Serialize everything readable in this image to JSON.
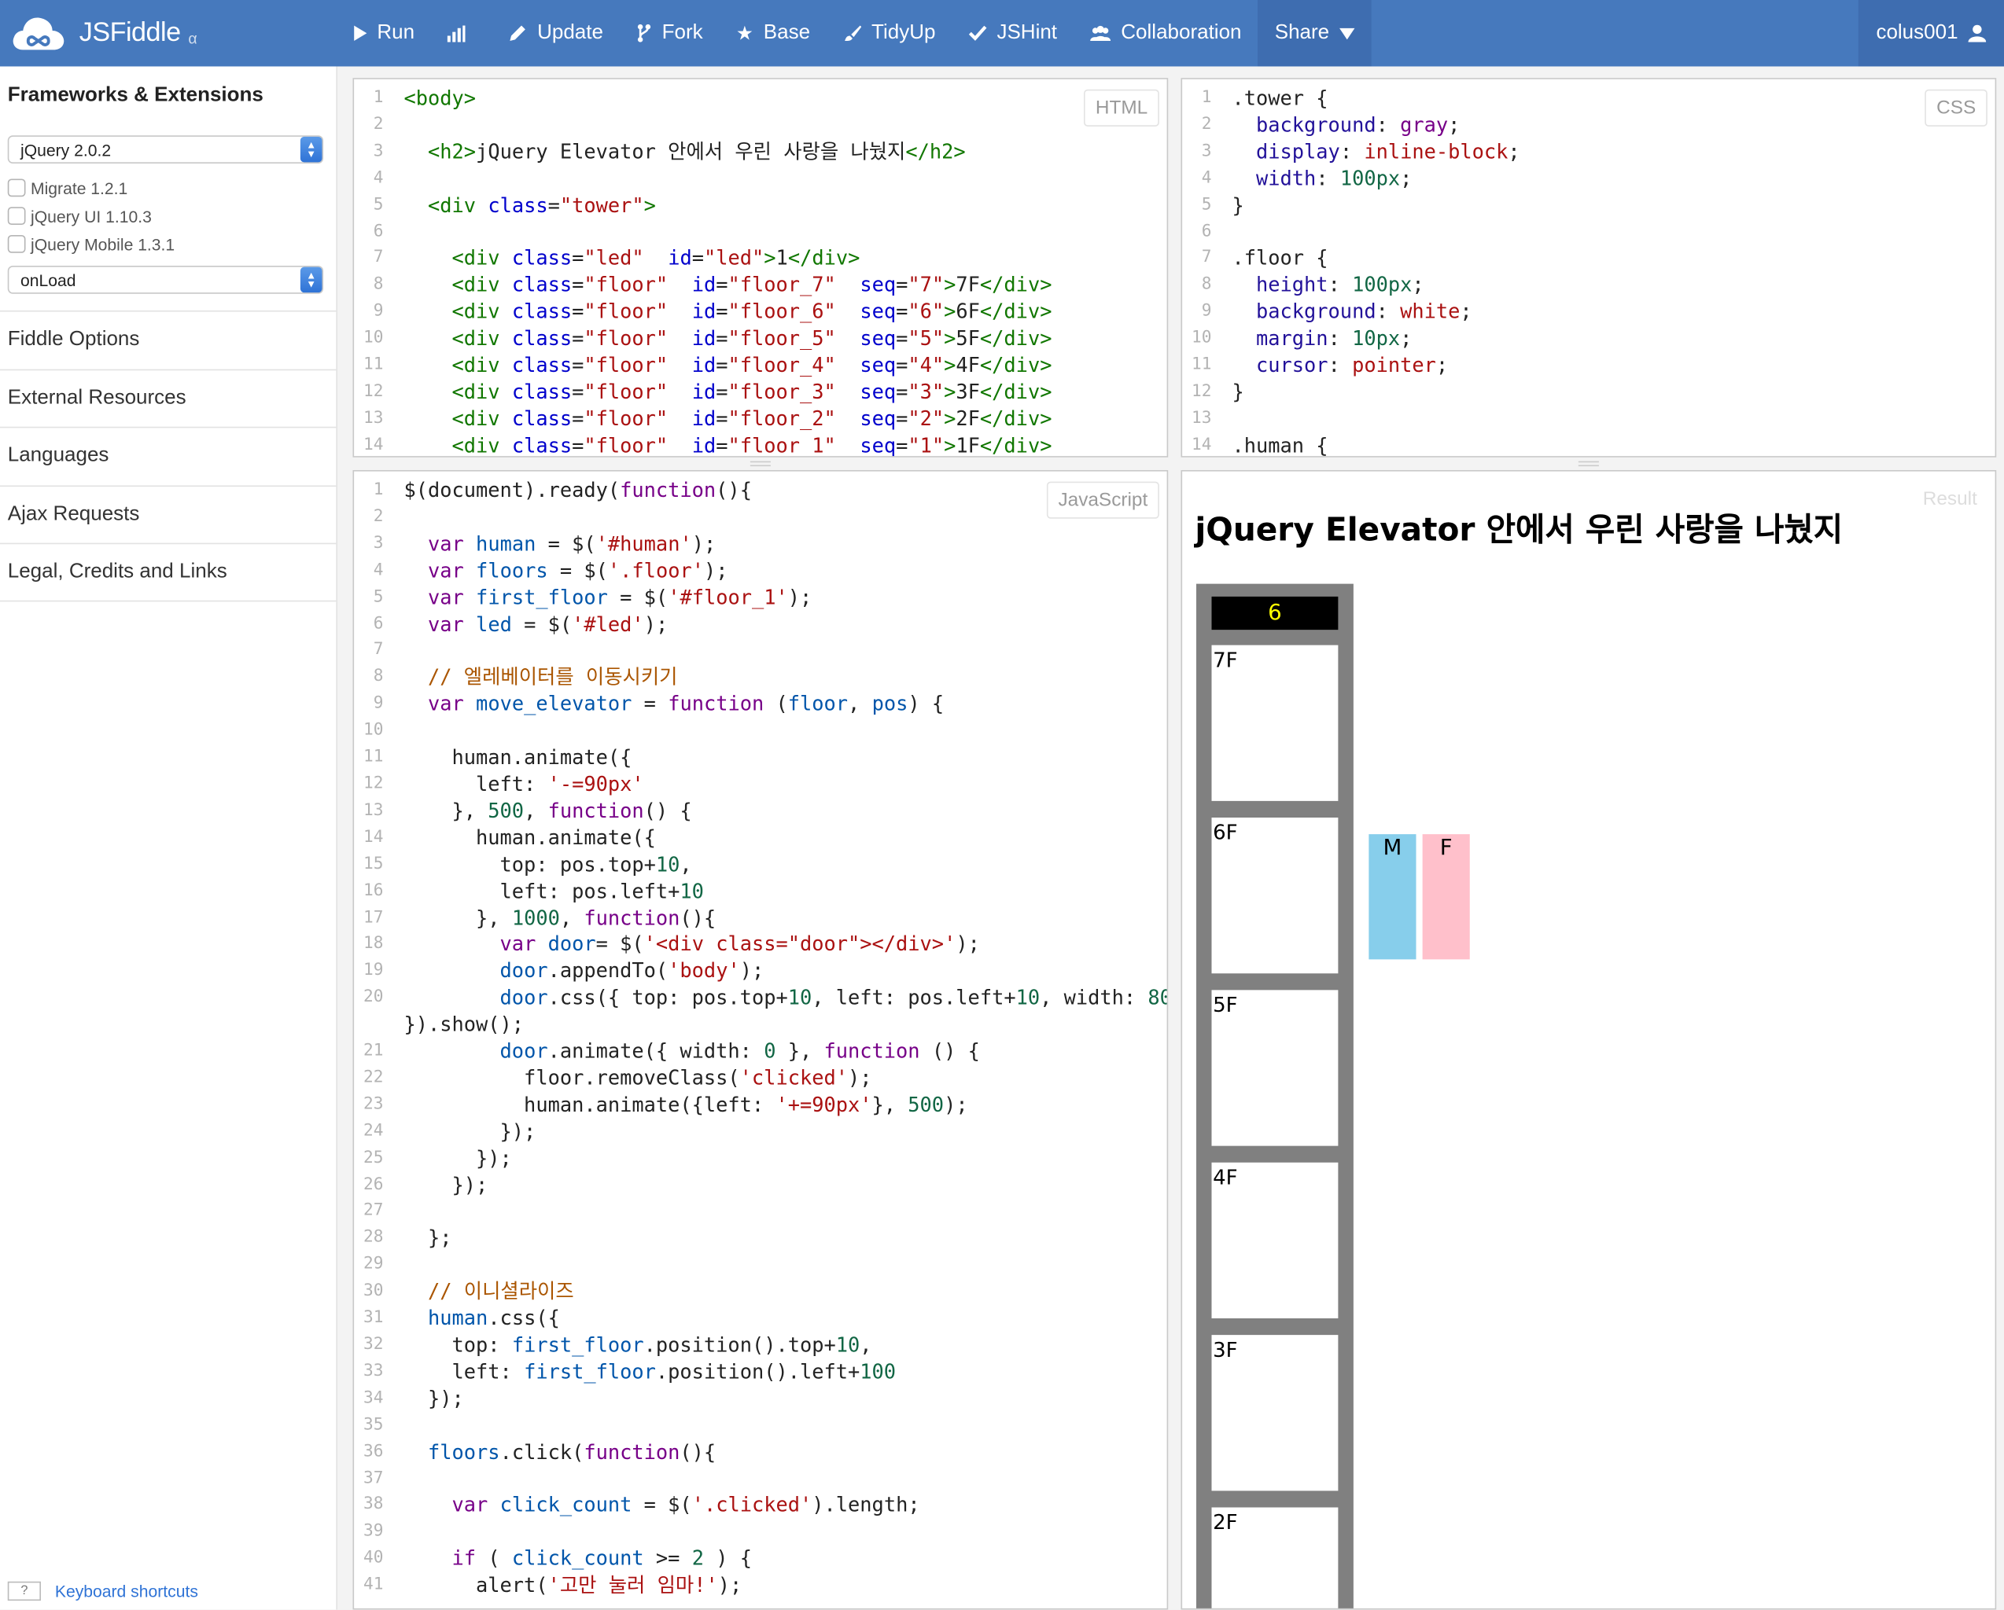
{
  "app": {
    "name": "JSFiddle",
    "version_mark": "α",
    "user": "colus001"
  },
  "toolbar": {
    "run": "Run",
    "update": "Update",
    "fork": "Fork",
    "base": "Base",
    "tidyup": "TidyUp",
    "jshint": "JSHint",
    "collaboration": "Collaboration",
    "share": "Share"
  },
  "sidebar": {
    "title": "Frameworks & Extensions",
    "framework": "jQuery 2.0.2",
    "extensions": [
      "Migrate 1.2.1",
      "jQuery UI 1.10.3",
      "jQuery Mobile 1.3.1"
    ],
    "load": "onLoad",
    "sections": [
      "Fiddle Options",
      "External Resources",
      "Languages",
      "Ajax Requests",
      "Legal, Credits and Links"
    ],
    "kb_key": "?",
    "kb_label": "Keyboard shortcuts"
  },
  "panels": {
    "html": "HTML",
    "css": "CSS",
    "js": "JavaScript",
    "result": "Result"
  },
  "html_code": [
    [
      [
        "tg",
        "<body>"
      ]
    ],
    [],
    [
      [
        "",
        "  "
      ],
      [
        "tg",
        "<h2>"
      ],
      [
        "",
        "jQuery Elevator 안에서 우린 사랑을 나눴지"
      ],
      [
        "tg",
        "</h2>"
      ]
    ],
    [],
    [
      [
        "",
        "  "
      ],
      [
        "tg",
        "<div "
      ],
      [
        "at",
        "class"
      ],
      [
        "",
        "="
      ],
      [
        "st",
        "\"tower\""
      ],
      [
        "tg",
        ">"
      ]
    ],
    [],
    [
      [
        "",
        "    "
      ],
      [
        "tg",
        "<div "
      ],
      [
        "at",
        "class"
      ],
      [
        "",
        "="
      ],
      [
        "st",
        "\"led\""
      ],
      [
        "",
        "  "
      ],
      [
        "at",
        "id"
      ],
      [
        "",
        "="
      ],
      [
        "st",
        "\"led\""
      ],
      [
        "tg",
        ">"
      ],
      [
        "",
        "1"
      ],
      [
        "tg",
        "</div>"
      ]
    ],
    [
      [
        "",
        "    "
      ],
      [
        "tg",
        "<div "
      ],
      [
        "at",
        "class"
      ],
      [
        "",
        "="
      ],
      [
        "st",
        "\"floor\""
      ],
      [
        "",
        ""
      ],
      [
        "",
        "  "
      ],
      [
        "at",
        "id"
      ],
      [
        "",
        "="
      ],
      [
        "st",
        "\"floor_7\""
      ],
      [
        "",
        "  "
      ],
      [
        "at",
        "seq"
      ],
      [
        "",
        "="
      ],
      [
        "st",
        "\"7\""
      ],
      [
        "tg",
        ">"
      ],
      [
        "",
        "7F"
      ],
      [
        "tg",
        "</div>"
      ]
    ],
    [
      [
        "",
        "    "
      ],
      [
        "tg",
        "<div "
      ],
      [
        "at",
        "class"
      ],
      [
        "",
        "="
      ],
      [
        "st",
        "\"floor\""
      ],
      [
        "",
        "  "
      ],
      [
        "at",
        "id"
      ],
      [
        "",
        "="
      ],
      [
        "st",
        "\"floor_6\""
      ],
      [
        "",
        "  "
      ],
      [
        "at",
        "seq"
      ],
      [
        "",
        "="
      ],
      [
        "st",
        "\"6\""
      ],
      [
        "tg",
        ">"
      ],
      [
        "",
        "6F"
      ],
      [
        "tg",
        "</div>"
      ]
    ],
    [
      [
        "",
        "    "
      ],
      [
        "tg",
        "<div "
      ],
      [
        "at",
        "class"
      ],
      [
        "",
        "="
      ],
      [
        "st",
        "\"floor\""
      ],
      [
        "",
        "  "
      ],
      [
        "at",
        "id"
      ],
      [
        "",
        "="
      ],
      [
        "st",
        "\"floor_5\""
      ],
      [
        "",
        "  "
      ],
      [
        "at",
        "seq"
      ],
      [
        "",
        "="
      ],
      [
        "st",
        "\"5\""
      ],
      [
        "tg",
        ">"
      ],
      [
        "",
        "5F"
      ],
      [
        "tg",
        "</div>"
      ]
    ],
    [
      [
        "",
        "    "
      ],
      [
        "tg",
        "<div "
      ],
      [
        "at",
        "class"
      ],
      [
        "",
        "="
      ],
      [
        "st",
        "\"floor\""
      ],
      [
        "",
        "  "
      ],
      [
        "at",
        "id"
      ],
      [
        "",
        "="
      ],
      [
        "st",
        "\"floor_4\""
      ],
      [
        "",
        "  "
      ],
      [
        "at",
        "seq"
      ],
      [
        "",
        "="
      ],
      [
        "st",
        "\"4\""
      ],
      [
        "tg",
        ">"
      ],
      [
        "",
        "4F"
      ],
      [
        "tg",
        "</div>"
      ]
    ],
    [
      [
        "",
        "    "
      ],
      [
        "tg",
        "<div "
      ],
      [
        "at",
        "class"
      ],
      [
        "",
        "="
      ],
      [
        "st",
        "\"floor\""
      ],
      [
        "",
        "  "
      ],
      [
        "at",
        "id"
      ],
      [
        "",
        "="
      ],
      [
        "st",
        "\"floor_3\""
      ],
      [
        "",
        "  "
      ],
      [
        "at",
        "seq"
      ],
      [
        "",
        "="
      ],
      [
        "st",
        "\"3\""
      ],
      [
        "tg",
        ">"
      ],
      [
        "",
        "3F"
      ],
      [
        "tg",
        "</div>"
      ]
    ],
    [
      [
        "",
        "    "
      ],
      [
        "tg",
        "<div "
      ],
      [
        "at",
        "class"
      ],
      [
        "",
        "="
      ],
      [
        "st",
        "\"floor\""
      ],
      [
        "",
        "  "
      ],
      [
        "at",
        "id"
      ],
      [
        "",
        "="
      ],
      [
        "st",
        "\"floor_2\""
      ],
      [
        "",
        "  "
      ],
      [
        "at",
        "seq"
      ],
      [
        "",
        "="
      ],
      [
        "st",
        "\"2\""
      ],
      [
        "tg",
        ">"
      ],
      [
        "",
        "2F"
      ],
      [
        "tg",
        "</div>"
      ]
    ],
    [
      [
        "",
        "    "
      ],
      [
        "tg",
        "<div "
      ],
      [
        "at",
        "class"
      ],
      [
        "",
        "="
      ],
      [
        "st",
        "\"floor\""
      ],
      [
        "",
        "  "
      ],
      [
        "at",
        "id"
      ],
      [
        "",
        "="
      ],
      [
        "st",
        "\"floor_1\""
      ],
      [
        "",
        "  "
      ],
      [
        "at",
        "seq"
      ],
      [
        "",
        "="
      ],
      [
        "st",
        "\"1\""
      ],
      [
        "tg",
        ">"
      ],
      [
        "",
        "1F"
      ],
      [
        "tg",
        "</div>"
      ]
    ]
  ],
  "css_code": [
    [
      [
        "",
        ".tower {"
      ]
    ],
    [
      [
        "",
        "  "
      ],
      [
        "at2",
        "background"
      ],
      [
        "",
        ": "
      ],
      [
        "gl",
        "gray"
      ],
      [
        "",
        ";"
      ]
    ],
    [
      [
        "",
        "  "
      ],
      [
        "at2",
        "display"
      ],
      [
        "",
        ": "
      ],
      [
        "st",
        "inline-block"
      ],
      [
        "",
        ";"
      ]
    ],
    [
      [
        "",
        "  "
      ],
      [
        "at2",
        "width"
      ],
      [
        "",
        ": "
      ],
      [
        "nm",
        "100px"
      ],
      [
        "",
        ";"
      ]
    ],
    [
      [
        "",
        "}"
      ]
    ],
    [],
    [
      [
        "",
        ".floor {"
      ]
    ],
    [
      [
        "",
        "  "
      ],
      [
        "at2",
        "height"
      ],
      [
        "",
        ": "
      ],
      [
        "nm",
        "100px"
      ],
      [
        "",
        ";"
      ]
    ],
    [
      [
        "",
        "  "
      ],
      [
        "at2",
        "background"
      ],
      [
        "",
        ": "
      ],
      [
        "st",
        "white"
      ],
      [
        "",
        ";"
      ]
    ],
    [
      [
        "",
        "  "
      ],
      [
        "at2",
        "margin"
      ],
      [
        "",
        ": "
      ],
      [
        "nm",
        "10px"
      ],
      [
        "",
        ";"
      ]
    ],
    [
      [
        "",
        "  "
      ],
      [
        "at2",
        "cursor"
      ],
      [
        "",
        ": "
      ],
      [
        "st",
        "pointer"
      ],
      [
        "",
        ";"
      ]
    ],
    [
      [
        "",
        "}"
      ]
    ],
    [],
    [
      [
        "",
        ".human {"
      ]
    ]
  ],
  "js_code": [
    [
      [
        "",
        "$(document).ready("
      ],
      [
        "kw",
        "function"
      ],
      [
        "",
        "(){"
      ]
    ],
    [],
    [
      [
        "",
        "  "
      ],
      [
        "kw",
        "var "
      ],
      [
        "vr",
        "human"
      ],
      [
        "",
        " = $("
      ],
      [
        "st",
        "'#human'"
      ],
      [
        "",
        ");"
      ]
    ],
    [
      [
        "",
        "  "
      ],
      [
        "kw",
        "var "
      ],
      [
        "vr",
        "floors"
      ],
      [
        "",
        " = $("
      ],
      [
        "st",
        "'.floor'"
      ],
      [
        "",
        ");"
      ]
    ],
    [
      [
        "",
        "  "
      ],
      [
        "kw",
        "var "
      ],
      [
        "vr",
        "first_floor"
      ],
      [
        "",
        " = $("
      ],
      [
        "st",
        "'#floor_1'"
      ],
      [
        "",
        ");"
      ]
    ],
    [
      [
        "",
        "  "
      ],
      [
        "kw",
        "var "
      ],
      [
        "vr",
        "led"
      ],
      [
        "",
        " = $("
      ],
      [
        "st",
        "'#led'"
      ],
      [
        "",
        ");"
      ]
    ],
    [],
    [
      [
        "",
        "  "
      ],
      [
        "cm",
        "// 엘레베이터를 이동시키기"
      ]
    ],
    [
      [
        "",
        "  "
      ],
      [
        "kw",
        "var "
      ],
      [
        "vr",
        "move_elevator"
      ],
      [
        "",
        " = "
      ],
      [
        "kw",
        "function"
      ],
      [
        "",
        " ("
      ],
      [
        "vr",
        "floor"
      ],
      [
        "",
        ", "
      ],
      [
        "vr",
        "pos"
      ],
      [
        "",
        ") {"
      ]
    ],
    [],
    [
      [
        "",
        "    human.animate({"
      ]
    ],
    [
      [
        "",
        "      left: "
      ],
      [
        "st",
        "'-=90px'"
      ]
    ],
    [
      [
        "",
        "    }, "
      ],
      [
        "nm",
        "500"
      ],
      [
        "",
        ", "
      ],
      [
        "kw",
        "function"
      ],
      [
        "",
        "() {"
      ]
    ],
    [
      [
        "",
        "      human.animate({"
      ]
    ],
    [
      [
        "",
        "        top: pos.top+"
      ],
      [
        "nm",
        "10"
      ],
      [
        "",
        ","
      ]
    ],
    [
      [
        "",
        "        left: pos.left+"
      ],
      [
        "nm",
        "10"
      ]
    ],
    [
      [
        "",
        "      }, "
      ],
      [
        "nm",
        "1000"
      ],
      [
        "",
        ", "
      ],
      [
        "kw",
        "function"
      ],
      [
        "",
        "(){"
      ]
    ],
    [
      [
        "",
        "        "
      ],
      [
        "kw",
        "var "
      ],
      [
        "vr",
        "door"
      ],
      [
        "",
        "= $("
      ],
      [
        "st",
        "'<div class=\"door\"></div>'"
      ],
      [
        "",
        ");"
      ]
    ],
    [
      [
        "",
        "        "
      ],
      [
        "vr",
        "door"
      ],
      [
        "",
        ".appendTo("
      ],
      [
        "st",
        "'body'"
      ],
      [
        "",
        ");"
      ]
    ],
    [
      [
        "",
        "        "
      ],
      [
        "vr",
        "door"
      ],
      [
        "",
        ".css({ top: pos.top+"
      ],
      [
        "nm",
        "10"
      ],
      [
        "",
        ", left: pos.left+"
      ],
      [
        "nm",
        "10"
      ],
      [
        "",
        ", width: "
      ],
      [
        "nm",
        "80"
      ]
    ],
    [
      [
        "",
        "}).show();"
      ]
    ],
    [
      [
        "",
        "        "
      ],
      [
        "vr",
        "door"
      ],
      [
        "",
        ".animate({ width: "
      ],
      [
        "nm",
        "0"
      ],
      [
        "",
        " }, "
      ],
      [
        "kw",
        "function"
      ],
      [
        "",
        " () {"
      ]
    ],
    [
      [
        "",
        "          floor.removeClass("
      ],
      [
        "st",
        "'clicked'"
      ],
      [
        "",
        ");"
      ]
    ],
    [
      [
        "",
        "          human.animate({left: "
      ],
      [
        "st",
        "'+=90px'"
      ],
      [
        "",
        "}, "
      ],
      [
        "nm",
        "500"
      ],
      [
        "",
        ");"
      ]
    ],
    [
      [
        "",
        "        });"
      ]
    ],
    [
      [
        "",
        "      });"
      ]
    ],
    [
      [
        "",
        "    });"
      ]
    ],
    [],
    [
      [
        "",
        "  };"
      ]
    ],
    [],
    [
      [
        "",
        "  "
      ],
      [
        "cm",
        "// 이니셜라이즈"
      ]
    ],
    [
      [
        "",
        "  "
      ],
      [
        "vr",
        "human"
      ],
      [
        "",
        ".css({"
      ]
    ],
    [
      [
        "",
        "    top: "
      ],
      [
        "vr",
        "first_floor"
      ],
      [
        "",
        ".position().top+"
      ],
      [
        "nm",
        "10"
      ],
      [
        "",
        ","
      ]
    ],
    [
      [
        "",
        "    left: "
      ],
      [
        "vr",
        "first_floor"
      ],
      [
        "",
        ".position().left+"
      ],
      [
        "nm",
        "100"
      ]
    ],
    [
      [
        "",
        "  });"
      ]
    ],
    [],
    [
      [
        "",
        "  "
      ],
      [
        "vr",
        "floors"
      ],
      [
        "",
        ".click("
      ],
      [
        "kw",
        "function"
      ],
      [
        "",
        "(){"
      ]
    ],
    [],
    [
      [
        "",
        "    "
      ],
      [
        "kw",
        "var "
      ],
      [
        "vr",
        "click_count"
      ],
      [
        "",
        " = $("
      ],
      [
        "st",
        "'.clicked'"
      ],
      [
        "",
        ").length;"
      ]
    ],
    [],
    [
      [
        "",
        "    "
      ],
      [
        "kw",
        "if"
      ],
      [
        "",
        " ( "
      ],
      [
        "vr",
        "click_count"
      ],
      [
        "",
        " >= "
      ],
      [
        "nm",
        "2"
      ],
      [
        "",
        " ) {"
      ]
    ],
    [
      [
        "",
        "      alert("
      ],
      [
        "st",
        "'고만 눌러 임마!'"
      ],
      [
        "",
        ");"
      ]
    ]
  ],
  "js_line_numbers": [
    "1",
    "2",
    "3",
    "4",
    "5",
    "6",
    "7",
    "8",
    "9",
    "10",
    "11",
    "12",
    "13",
    "14",
    "15",
    "16",
    "17",
    "18",
    "19",
    "20",
    "",
    "21",
    "22",
    "23",
    "24",
    "25",
    "26",
    "27",
    "28",
    "29",
    "30",
    "31",
    "32",
    "33",
    "34",
    "35",
    "36",
    "37",
    "38",
    "39",
    "40",
    "41"
  ],
  "result": {
    "heading": "jQuery Elevator 안에서 우린 사랑을 나눴지",
    "led": "6",
    "floors": [
      "7F",
      "6F",
      "5F",
      "4F",
      "3F",
      "2F"
    ],
    "humans": [
      {
        "label": "M",
        "color": "#87ceeb"
      },
      {
        "label": "F",
        "color": "#ffc0cb"
      }
    ]
  },
  "colors": {
    "topbar": "#4679bd",
    "accent": "#2f73d6",
    "tower": "#808080",
    "led_text": "#ffff00"
  }
}
